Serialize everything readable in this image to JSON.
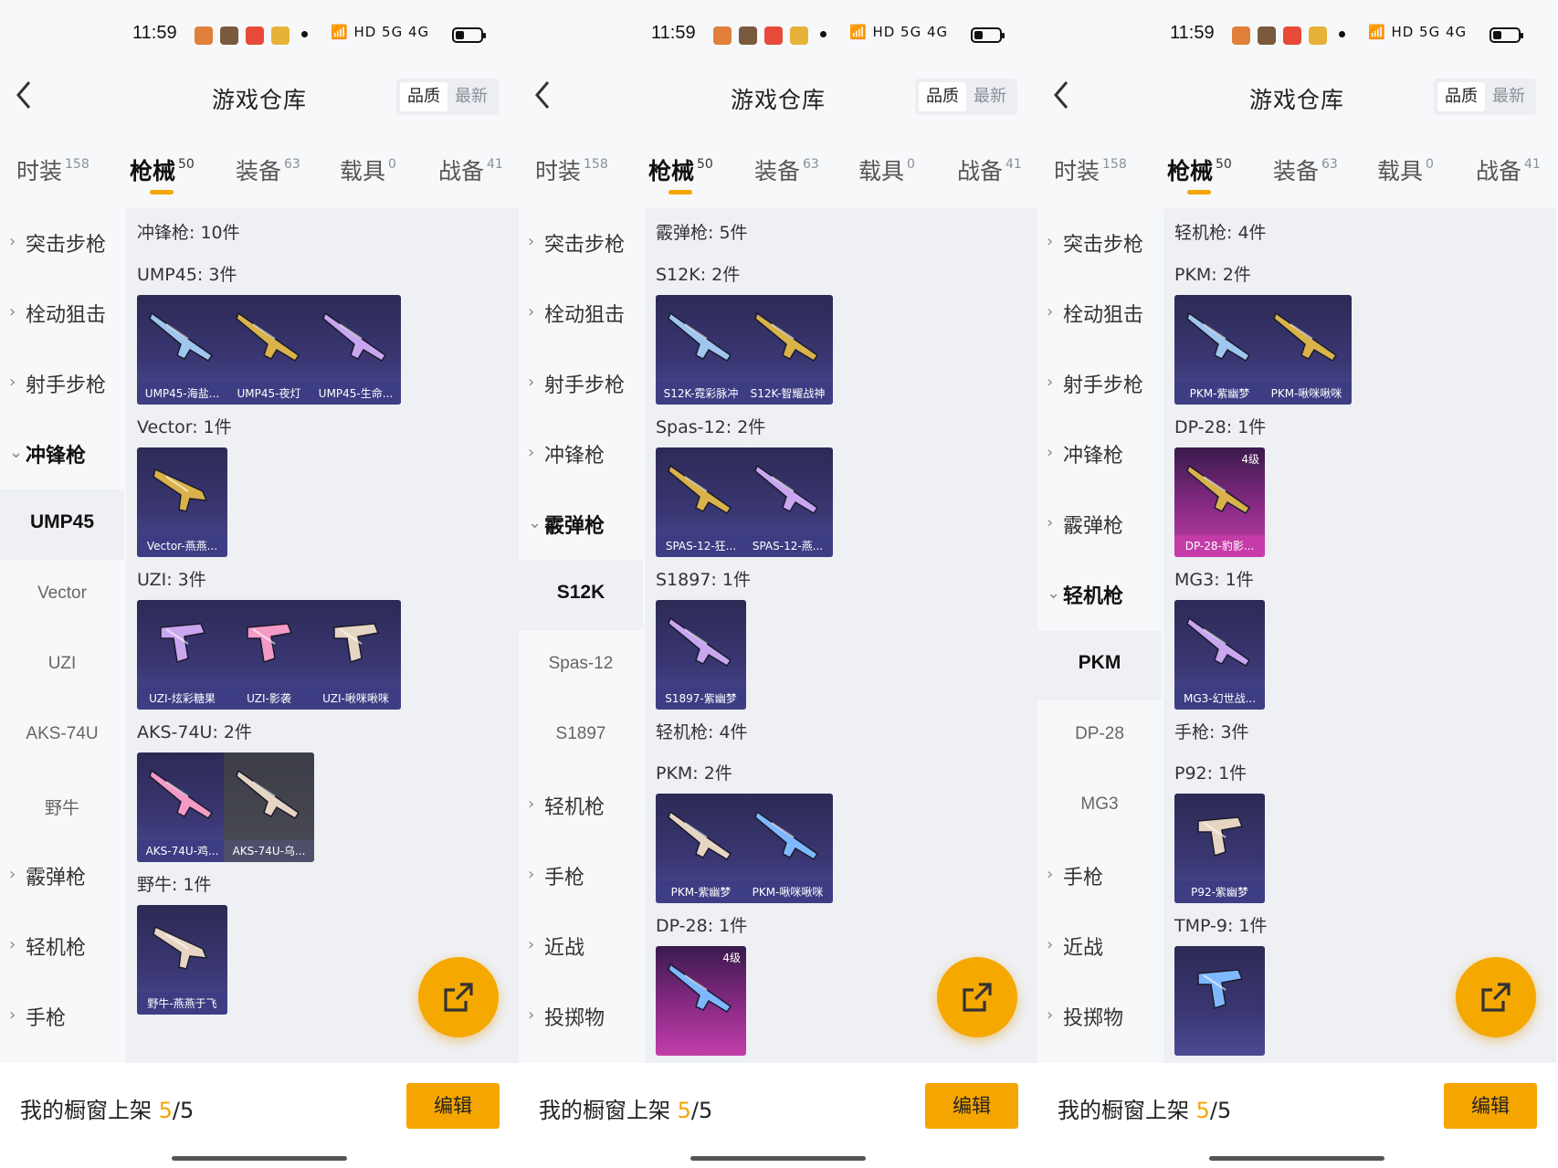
{
  "status": {
    "time": "11:59",
    "signal_text": "HD 5G 4G"
  },
  "header": {
    "title": "游戏仓库",
    "sort_quality": "品质",
    "sort_latest": "最新"
  },
  "tabs": [
    {
      "label": "时装",
      "count": "158"
    },
    {
      "label": "枪械",
      "count": "50"
    },
    {
      "label": "装备",
      "count": "63"
    },
    {
      "label": "载具",
      "count": "0"
    },
    {
      "label": "战备",
      "count": "41"
    }
  ],
  "bottom": {
    "prefix": "我的橱窗上架 ",
    "current": "5",
    "total": "/5",
    "edit": "编辑"
  },
  "colors": {
    "accent": "#f5a500",
    "card_bg": "#3a3774",
    "pink_card": "#c23fa9"
  },
  "panels": [
    {
      "sidebar": [
        {
          "label": "突击步枪",
          "state": "collapsed"
        },
        {
          "label": "栓动狙击",
          "state": "collapsed"
        },
        {
          "label": "射手步枪",
          "state": "collapsed"
        },
        {
          "label": "冲锋枪",
          "state": "open"
        },
        {
          "label": "UMP45",
          "state": "sub-selected"
        },
        {
          "label": "Vector",
          "state": "sub"
        },
        {
          "label": "UZI",
          "state": "sub"
        },
        {
          "label": "AKS-74U",
          "state": "sub"
        },
        {
          "label": "野牛",
          "state": "sub"
        },
        {
          "label": "霰弹枪",
          "state": "collapsed"
        },
        {
          "label": "轻机枪",
          "state": "collapsed"
        },
        {
          "label": "手枪",
          "state": "collapsed"
        }
      ],
      "section_header": "冲锋枪: 10件",
      "groups": [
        {
          "title": "UMP45: 3件",
          "items": [
            {
              "name": "UMP45-海盐...",
              "style": "blue",
              "icon": "rifle-icon"
            },
            {
              "name": "UMP45-夜灯",
              "style": "blue",
              "icon": "rifle-icon"
            },
            {
              "name": "UMP45-生命...",
              "style": "blue",
              "icon": "rifle-icon"
            }
          ]
        },
        {
          "title": "Vector: 1件",
          "items": [
            {
              "name": "Vector-燕燕...",
              "style": "blue",
              "icon": "smg-icon"
            }
          ]
        },
        {
          "title": "UZI: 3件",
          "items": [
            {
              "name": "UZI-炫彩糖果",
              "style": "blue",
              "icon": "uzi-icon"
            },
            {
              "name": "UZI-影袭",
              "style": "blue",
              "icon": "uzi-icon"
            },
            {
              "name": "UZI-啾咪啾咪",
              "style": "blue",
              "icon": "uzi-icon"
            }
          ]
        },
        {
          "title": "AKS-74U: 2件",
          "items": [
            {
              "name": "AKS-74U-鸡...",
              "style": "blue",
              "icon": "rifle-icon"
            },
            {
              "name": "AKS-74U-乌...",
              "style": "grey",
              "icon": "rifle-icon"
            }
          ]
        },
        {
          "title": "野牛: 1件",
          "items": [
            {
              "name": "野牛-燕燕于飞",
              "style": "blue",
              "icon": "smg-icon"
            }
          ]
        }
      ]
    },
    {
      "sidebar": [
        {
          "label": "突击步枪",
          "state": "collapsed"
        },
        {
          "label": "栓动狙击",
          "state": "collapsed"
        },
        {
          "label": "射手步枪",
          "state": "collapsed"
        },
        {
          "label": "冲锋枪",
          "state": "collapsed"
        },
        {
          "label": "霰弹枪",
          "state": "open"
        },
        {
          "label": "S12K",
          "state": "sub-selected"
        },
        {
          "label": "Spas-12",
          "state": "sub"
        },
        {
          "label": "S1897",
          "state": "sub"
        },
        {
          "label": "轻机枪",
          "state": "collapsed"
        },
        {
          "label": "手枪",
          "state": "collapsed"
        },
        {
          "label": "近战",
          "state": "collapsed"
        },
        {
          "label": "投掷物",
          "state": "collapsed"
        }
      ],
      "section_header": "霰弹枪: 5件",
      "groups": [
        {
          "title": "S12K: 2件",
          "items": [
            {
              "name": "S12K-霓彩脉冲",
              "style": "blue",
              "icon": "shotgun-icon"
            },
            {
              "name": "S12K-智耀战神",
              "style": "blue",
              "icon": "shotgun-icon"
            }
          ]
        },
        {
          "title": "Spas-12: 2件",
          "items": [
            {
              "name": "SPAS-12-狂...",
              "style": "blue",
              "icon": "shotgun-icon"
            },
            {
              "name": "SPAS-12-燕...",
              "style": "blue",
              "icon": "shotgun-icon"
            }
          ]
        },
        {
          "title": "S1897: 1件",
          "items": [
            {
              "name": "S1897-紫幽梦",
              "style": "blue",
              "icon": "shotgun-icon"
            }
          ]
        },
        {
          "title": "轻机枪: 4件",
          "items": []
        },
        {
          "title": "PKM: 2件",
          "items": [
            {
              "name": "PKM-紫幽梦",
              "style": "blue",
              "icon": "lmg-icon"
            },
            {
              "name": "PKM-啾咪啾咪",
              "style": "blue",
              "icon": "lmg-icon"
            }
          ]
        },
        {
          "title": "DP-28: 1件",
          "items": [
            {
              "name": "",
              "style": "pink",
              "tier": "4级",
              "icon": "lmg-icon"
            }
          ]
        }
      ]
    },
    {
      "sidebar": [
        {
          "label": "突击步枪",
          "state": "collapsed"
        },
        {
          "label": "栓动狙击",
          "state": "collapsed"
        },
        {
          "label": "射手步枪",
          "state": "collapsed"
        },
        {
          "label": "冲锋枪",
          "state": "collapsed"
        },
        {
          "label": "霰弹枪",
          "state": "collapsed"
        },
        {
          "label": "轻机枪",
          "state": "open"
        },
        {
          "label": "PKM",
          "state": "sub-selected"
        },
        {
          "label": "DP-28",
          "state": "sub"
        },
        {
          "label": "MG3",
          "state": "sub"
        },
        {
          "label": "手枪",
          "state": "collapsed"
        },
        {
          "label": "近战",
          "state": "collapsed"
        },
        {
          "label": "投掷物",
          "state": "collapsed"
        }
      ],
      "section_header": "轻机枪: 4件",
      "groups": [
        {
          "title": "PKM: 2件",
          "items": [
            {
              "name": "PKM-紫幽梦",
              "style": "blue",
              "icon": "lmg-icon"
            },
            {
              "name": "PKM-啾咪啾咪",
              "style": "blue",
              "icon": "lmg-icon"
            }
          ]
        },
        {
          "title": "DP-28: 1件",
          "items": [
            {
              "name": "DP-28-豹影...",
              "style": "pink",
              "tier": "4级",
              "icon": "lmg-icon"
            }
          ]
        },
        {
          "title": "MG3: 1件",
          "items": [
            {
              "name": "MG3-幻世战...",
              "style": "blue",
              "icon": "lmg-icon"
            }
          ]
        },
        {
          "title": "手枪: 3件",
          "items": []
        },
        {
          "title": "P92: 1件",
          "items": [
            {
              "name": "P92-紫幽梦",
              "style": "blue",
              "icon": "pistol-icon"
            }
          ]
        },
        {
          "title": "TMP-9: 1件",
          "items": [
            {
              "name": "",
              "style": "blue",
              "icon": "pistol-icon"
            }
          ]
        }
      ]
    }
  ]
}
